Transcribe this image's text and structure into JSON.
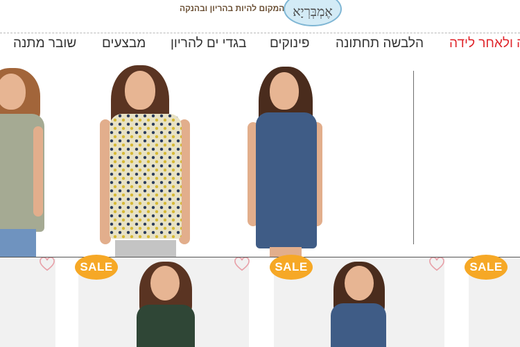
{
  "header": {
    "logo_text": "אֶמְבְּרְיָא",
    "tagline": "המקום להיות בהריון ובהנקה"
  },
  "nav": {
    "items": [
      {
        "label": "שובר מתנה"
      },
      {
        "label": "מבצעים"
      },
      {
        "label": "בגדי ים להריון"
      },
      {
        "label": "פינוקים"
      },
      {
        "label": "הלבשה תחתונה"
      },
      {
        "label": "ה ולאחר לידה",
        "active": true
      }
    ]
  },
  "products": {
    "sale_badges": [
      "SALE",
      "SALE",
      "SALE"
    ]
  },
  "colors": {
    "accent_red": "#e0262c",
    "sale_orange": "#f6a826",
    "logo_blue": "#d3ebf6",
    "heart_pink": "#e8a0a8"
  },
  "icons": [
    "heart-icon",
    "sale-badge"
  ]
}
